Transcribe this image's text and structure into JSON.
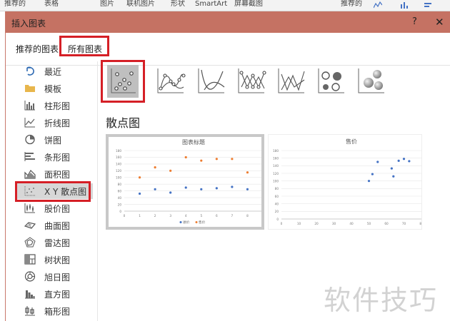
{
  "ribbon": {
    "items": [
      "推荐的",
      "表格",
      "图片",
      "联机图片",
      "形状",
      "SmartArt",
      "屏幕截图",
      "推荐的"
    ]
  },
  "dialog": {
    "title": "插入图表",
    "help_label": "?",
    "close_label": "✕"
  },
  "tabs": [
    {
      "label": "推荐的图表",
      "selected": false
    },
    {
      "label": "所有图表",
      "selected": true
    }
  ],
  "sidebar": {
    "items": [
      {
        "label": "最近",
        "icon": "recent-icon"
      },
      {
        "label": "模板",
        "icon": "folder-icon"
      },
      {
        "label": "柱形图",
        "icon": "column-chart-icon"
      },
      {
        "label": "折线图",
        "icon": "line-chart-icon"
      },
      {
        "label": "饼图",
        "icon": "pie-chart-icon"
      },
      {
        "label": "条形图",
        "icon": "bar-chart-icon"
      },
      {
        "label": "面积图",
        "icon": "area-chart-icon"
      },
      {
        "label": "X Y 散点图",
        "icon": "scatter-chart-icon",
        "selected": true
      },
      {
        "label": "股价图",
        "icon": "stock-chart-icon"
      },
      {
        "label": "曲面图",
        "icon": "surface-chart-icon"
      },
      {
        "label": "雷达图",
        "icon": "radar-chart-icon"
      },
      {
        "label": "树状图",
        "icon": "treemap-chart-icon"
      },
      {
        "label": "旭日图",
        "icon": "sunburst-chart-icon"
      },
      {
        "label": "直方图",
        "icon": "histogram-chart-icon"
      },
      {
        "label": "箱形图",
        "icon": "boxplot-chart-icon"
      }
    ]
  },
  "subtypes": [
    {
      "icon": "scatter-icon",
      "selected": true
    },
    {
      "icon": "scatter-smooth-lines-markers-icon"
    },
    {
      "icon": "scatter-smooth-lines-icon"
    },
    {
      "icon": "scatter-straight-lines-markers-icon"
    },
    {
      "icon": "scatter-straight-lines-icon"
    },
    {
      "icon": "bubble-icon"
    },
    {
      "icon": "bubble-3d-icon"
    }
  ],
  "section_title": "散点图",
  "watermark": "软件技巧",
  "colors": {
    "title_bar": "#c57263",
    "highlight": "#d51f26",
    "series_blue": "#4472c4",
    "series_orange": "#ed7d31"
  },
  "chart_data": [
    {
      "type": "scatter",
      "title": "图表标题",
      "xlim": [
        0,
        9
      ],
      "ylim": [
        0,
        180
      ],
      "x_ticks": [
        "0",
        "1",
        "2",
        "3",
        "4",
        "5",
        "6",
        "7",
        "8",
        "9"
      ],
      "y_ticks": [
        "0",
        "20",
        "40",
        "60",
        "80",
        "100",
        "120",
        "140",
        "160",
        "180"
      ],
      "series": [
        {
          "name": "进价",
          "color": "#4472c4",
          "x": [
            1,
            2,
            3,
            4,
            5,
            6,
            7,
            8
          ],
          "y": [
            52,
            65,
            55,
            70,
            65,
            68,
            72,
            65
          ]
        },
        {
          "name": "售价",
          "color": "#ed7d31",
          "x": [
            1,
            2,
            3,
            4,
            5,
            6,
            7,
            8
          ],
          "y": [
            100,
            130,
            120,
            160,
            150,
            155,
            155,
            115
          ]
        }
      ],
      "legend": "bottom"
    },
    {
      "type": "scatter",
      "title": "售价",
      "xlim": [
        0,
        80
      ],
      "ylim": [
        0,
        180
      ],
      "x_ticks": [
        "0",
        "10",
        "20",
        "30",
        "40",
        "50",
        "60",
        "70",
        "80"
      ],
      "y_ticks": [
        "0",
        "20",
        "40",
        "60",
        "80",
        "100",
        "120",
        "140",
        "160",
        "180"
      ],
      "series": [
        {
          "name": "售价",
          "color": "#4472c4",
          "x": [
            50,
            52,
            55,
            63,
            64,
            67,
            70,
            73
          ],
          "y": [
            100,
            118,
            150,
            133,
            112,
            153,
            158,
            152
          ]
        }
      ],
      "legend": "none"
    }
  ]
}
